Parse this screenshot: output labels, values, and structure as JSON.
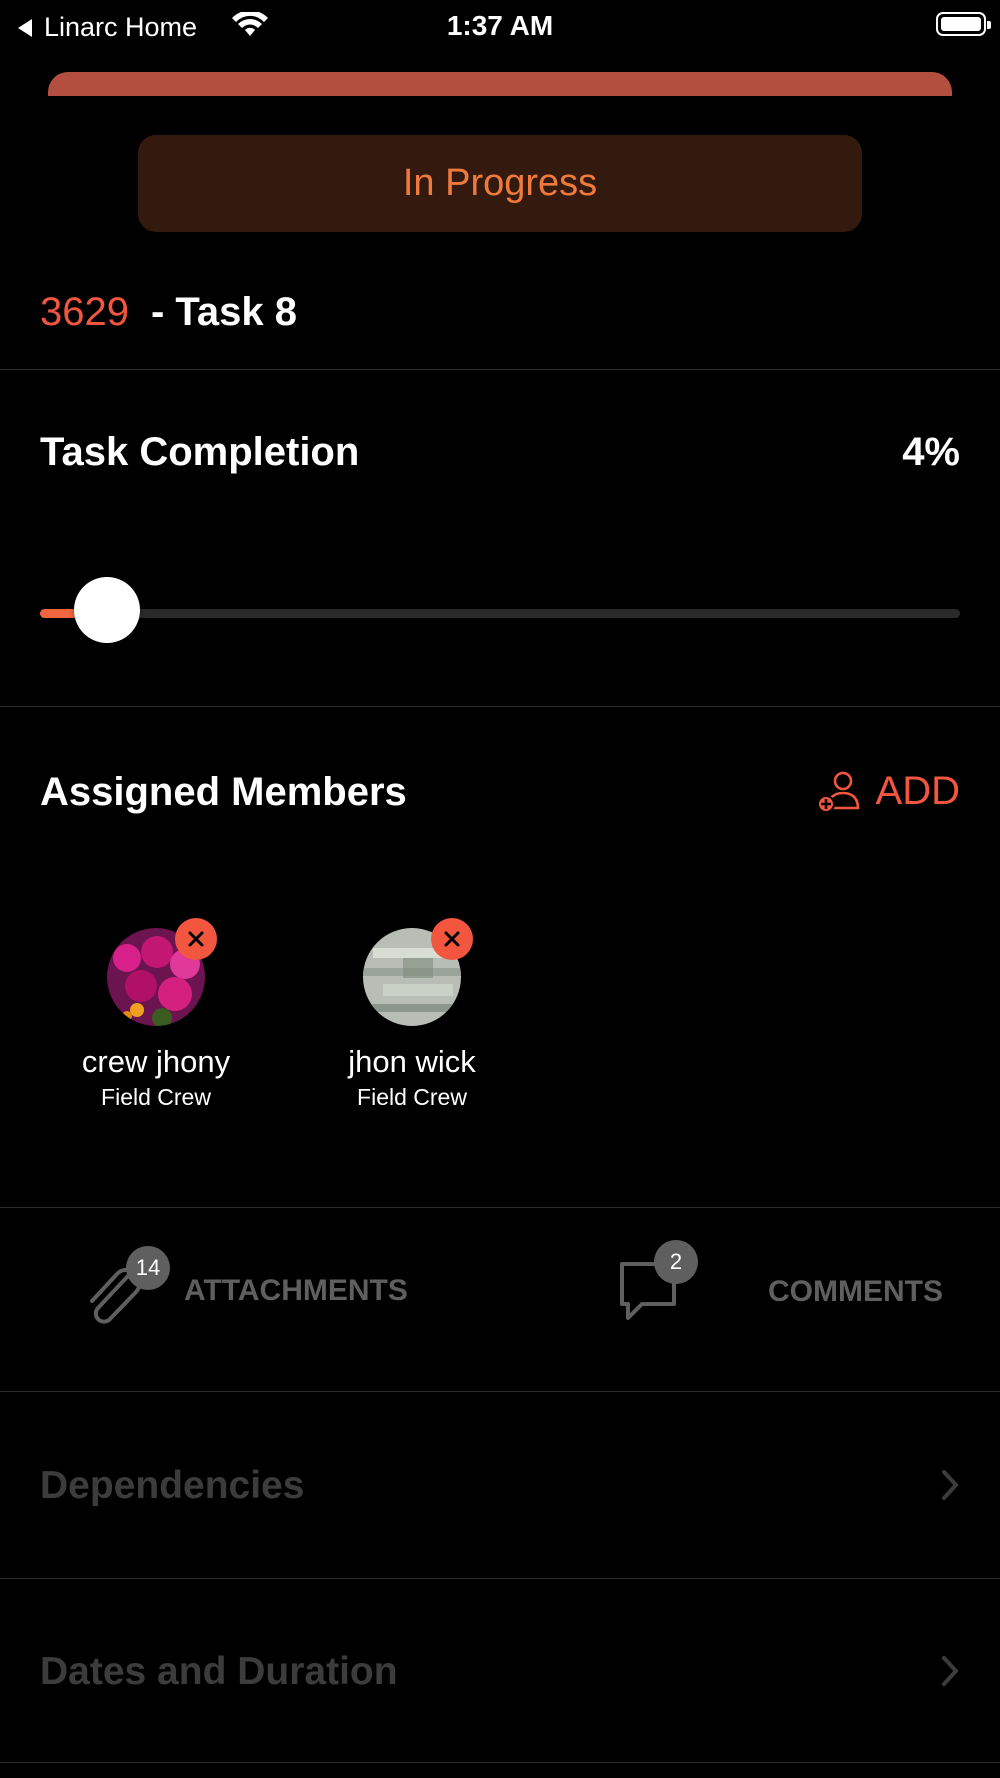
{
  "status_bar": {
    "back_app": "Linarc Home",
    "time": "1:37 AM"
  },
  "task": {
    "status": "In Progress",
    "id": "3629",
    "name": "- Task 8"
  },
  "completion": {
    "label": "Task Completion",
    "percent_text": "4%",
    "value": 0.04
  },
  "members": {
    "label": "Assigned Members",
    "add_label": "ADD",
    "list": [
      {
        "name": "crew jhony",
        "role": "Field Crew"
      },
      {
        "name": "jhon wick",
        "role": "Field Crew"
      }
    ]
  },
  "tabs": {
    "attachments": {
      "label": "ATTACHMENTS",
      "count": "14"
    },
    "comments": {
      "label": "COMMENTS",
      "count": "2"
    }
  },
  "rows": [
    {
      "label": "Dependencies"
    },
    {
      "label": "Dates and Duration"
    }
  ],
  "colors": {
    "accent": "#f2563f",
    "status_text": "#f07a3c",
    "status_bg": "#341a0e",
    "muted": "#5f5f5f"
  }
}
